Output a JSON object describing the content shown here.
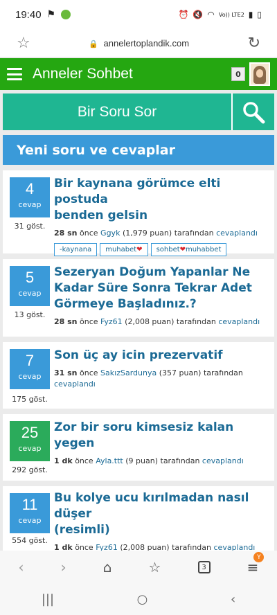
{
  "status_bar": {
    "time": "19:40",
    "network": "Vo)) LTE2"
  },
  "browser": {
    "url": "annelertoplandik.com"
  },
  "header": {
    "title": "Anneler Sohbet",
    "notification_count": "0"
  },
  "ask": {
    "button_label": "Bir Soru Sor"
  },
  "section": {
    "heading": "Yeni soru ve cevaplar"
  },
  "questions": [
    {
      "count": "4",
      "count_label": "cevap",
      "views": "31 göst.",
      "title_lines": [
        "Bir kaynana görümce elti postuda",
        "benden gelsin"
      ],
      "when": "28 sn",
      "ago": "önce",
      "user": "Ggyk",
      "points": "(1,979 puan)",
      "by": "tarafından",
      "action": "cevaplandı",
      "tags": [
        "-kaynana",
        "muhabet",
        "sohbet",
        "muhabbet"
      ]
    },
    {
      "count": "5",
      "count_label": "cevap",
      "views": "13 göst.",
      "title_lines": [
        "Sezeryan Doğum Yapanlar Ne",
        "Kadar Süre Sonra Tekrar Adet",
        "Görmeye Başladınız.?"
      ],
      "when": "28 sn",
      "ago": "önce",
      "user": "Fyz61",
      "points": "(2,008 puan)",
      "by": "tarafından",
      "action": "cevaplandı"
    },
    {
      "count": "7",
      "count_label": "cevap",
      "views": "175 göst.",
      "title_lines": [
        "Son üç ay icin prezervatif"
      ],
      "when": "31 sn",
      "ago": "önce",
      "user": "SakızSardunya",
      "points": "(357 puan)",
      "by": "tarafından",
      "action": "cevaplandı"
    },
    {
      "count": "25",
      "count_label": "cevap",
      "views": "292 göst.",
      "title_lines": [
        "Zor bir soru kimsesiz kalan yegen"
      ],
      "when": "1 dk",
      "ago": "önce",
      "user": "Ayla.ttt",
      "points": "(9 puan)",
      "by": "tarafından",
      "action": "cevaplandı"
    },
    {
      "count": "11",
      "count_label": "cevap",
      "views": "554 göst.",
      "title_lines": [
        "Bu kolye ucu kırılmadan nasıl düşer",
        "(resimli)"
      ],
      "when": "1 dk",
      "ago": "önce",
      "user": "Fyz61",
      "points": "(2,008 puan)",
      "by": "tarafından",
      "action": "cevaplandı"
    }
  ],
  "toolbar": {
    "tab_count": "3",
    "menu_badge": "Y"
  },
  "colors": {
    "header_green": "#25a711",
    "ask_teal": "#1fb692",
    "section_blue": "#3a9ad9",
    "count_green": "#2bab5b",
    "title_blue": "#1b6a95"
  }
}
